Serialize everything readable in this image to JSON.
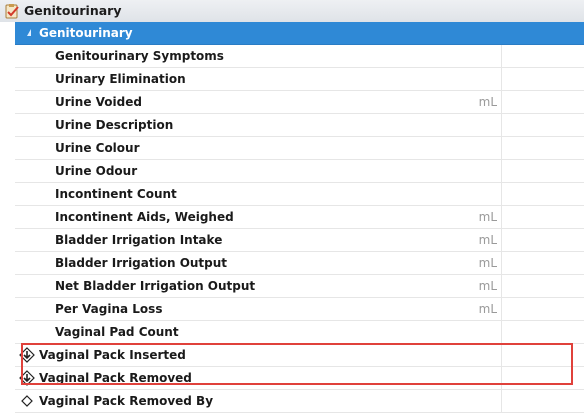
{
  "header": {
    "title": "Genitourinary",
    "icon": "clipboard-check-icon"
  },
  "group": {
    "label": "Genitourinary",
    "icon": "collapse-triangle-icon"
  },
  "rows": [
    {
      "label": "Genitourinary Symptoms",
      "unit": ""
    },
    {
      "label": "Urinary Elimination",
      "unit": ""
    },
    {
      "label": "Urine Voided",
      "unit": "mL"
    },
    {
      "label": "Urine Description",
      "unit": ""
    },
    {
      "label": "Urine Colour",
      "unit": ""
    },
    {
      "label": "Urine Odour",
      "unit": ""
    },
    {
      "label": "Incontinent Count",
      "unit": ""
    },
    {
      "label": "Incontinent Aids, Weighed",
      "unit": "mL"
    },
    {
      "label": "Bladder Irrigation Intake",
      "unit": "mL"
    },
    {
      "label": "Bladder Irrigation Output",
      "unit": "mL"
    },
    {
      "label": "Net Bladder Irrigation Output",
      "unit": "mL"
    },
    {
      "label": "Per Vagina Loss",
      "unit": "mL"
    },
    {
      "label": "Vaginal Pad Count",
      "unit": ""
    }
  ],
  "icon_rows": [
    {
      "label": "Vaginal Pack Inserted",
      "icon": "diamond-down-arrow-icon"
    },
    {
      "label": "Vaginal Pack Removed",
      "icon": "diamond-down-arrow-icon"
    },
    {
      "label": "Vaginal Pack Removed By",
      "icon": "diamond-outline-icon"
    }
  ],
  "colors": {
    "group_bg": "#2f89d6",
    "highlight": "#e0413b"
  }
}
